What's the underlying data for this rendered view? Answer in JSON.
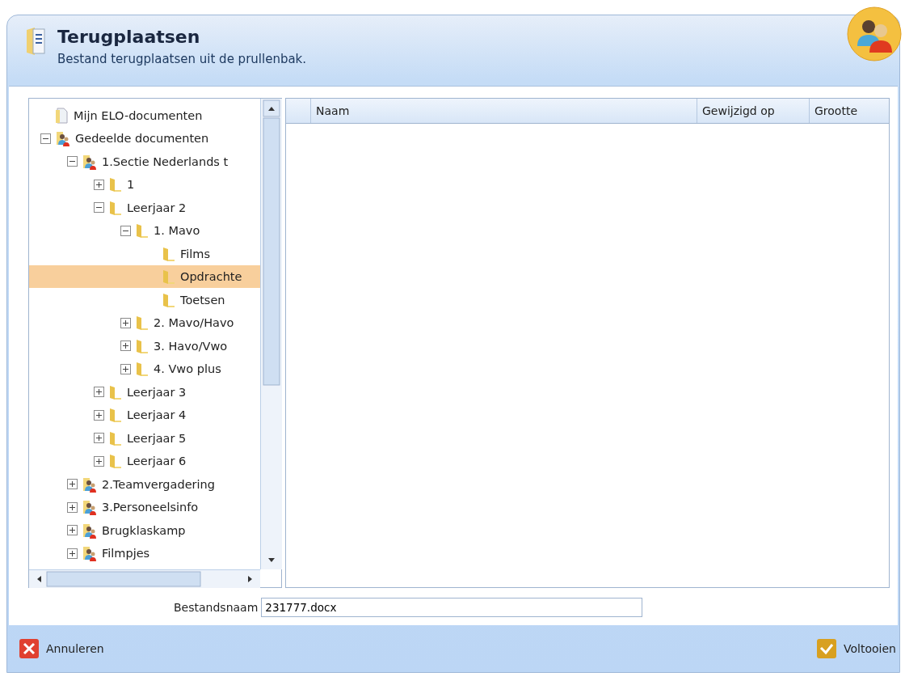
{
  "dialog": {
    "title": "Terugplaatsen",
    "subtitle": "Bestand terugplaatsen uit de prullenbak."
  },
  "tree": [
    {
      "label": "Mijn ELO-documenten",
      "kind": "document",
      "selected": false
    },
    {
      "label": "Gedeelde documenten",
      "kind": "shared",
      "selected": false,
      "expanded": true,
      "children": [
        {
          "label": "1.Sectie Nederlands t",
          "kind": "shared",
          "selected": false,
          "expanded": true,
          "children": [
            {
              "label": "1",
              "kind": "folder",
              "selected": false,
              "expanded": false
            },
            {
              "label": "Leerjaar 2",
              "kind": "folder",
              "selected": false,
              "expanded": true,
              "children": [
                {
                  "label": "1. Mavo",
                  "kind": "folder",
                  "selected": false,
                  "expanded": true,
                  "children": [
                    {
                      "label": "Films",
                      "kind": "folder",
                      "selected": false
                    },
                    {
                      "label": "Opdrachte",
                      "kind": "folder",
                      "selected": true
                    },
                    {
                      "label": "Toetsen",
                      "kind": "folder",
                      "selected": false
                    }
                  ]
                },
                {
                  "label": "2. Mavo/Havo",
                  "kind": "folder",
                  "selected": false,
                  "expanded": false
                },
                {
                  "label": "3. Havo/Vwo",
                  "kind": "folder",
                  "selected": false,
                  "expanded": false
                },
                {
                  "label": "4. Vwo plus",
                  "kind": "folder",
                  "selected": false,
                  "expanded": false
                }
              ]
            },
            {
              "label": "Leerjaar 3",
              "kind": "folder",
              "selected": false,
              "expanded": false
            },
            {
              "label": "Leerjaar 4",
              "kind": "folder",
              "selected": false,
              "expanded": false
            },
            {
              "label": "Leerjaar 5",
              "kind": "folder",
              "selected": false,
              "expanded": false
            },
            {
              "label": "Leerjaar 6",
              "kind": "folder",
              "selected": false,
              "expanded": false
            }
          ]
        },
        {
          "label": "2.Teamvergadering",
          "kind": "shared",
          "selected": false,
          "expanded": false
        },
        {
          "label": "3.Personeelsinfo",
          "kind": "shared",
          "selected": false,
          "expanded": false
        },
        {
          "label": "Brugklaskamp",
          "kind": "shared",
          "selected": false,
          "expanded": false
        },
        {
          "label": "Filmpjes",
          "kind": "shared",
          "selected": false,
          "expanded": false
        }
      ]
    }
  ],
  "table": {
    "columns": [
      "Naam",
      "Gewijzigd op",
      "Grootte"
    ]
  },
  "filename": {
    "label": "Bestandsnaam",
    "value": "231777.docx"
  },
  "buttons": [
    {
      "label": "Annuleren",
      "kind": "cancel"
    },
    {
      "label": "Voltooien",
      "kind": "confirm"
    }
  ]
}
